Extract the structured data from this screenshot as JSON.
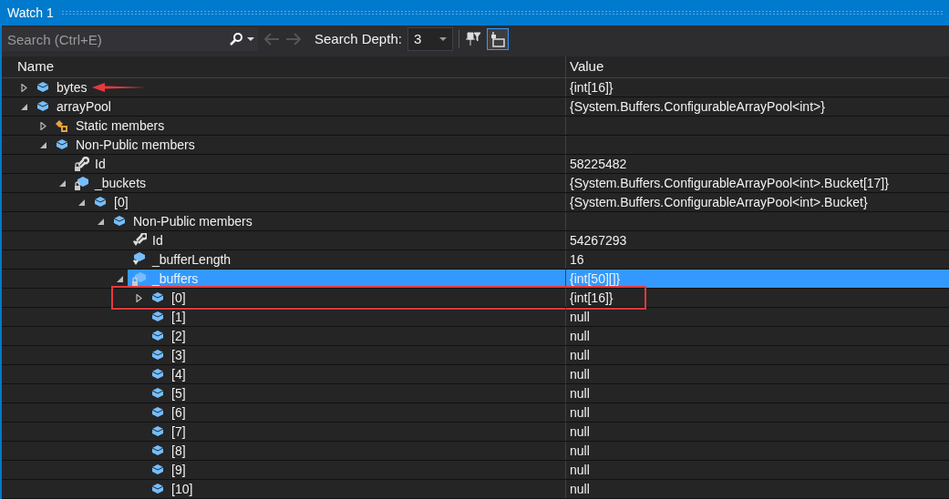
{
  "window": {
    "title": "Watch 1"
  },
  "toolbar": {
    "search": {
      "placeholder": "Search (Ctrl+E)"
    },
    "search_depth": {
      "label": "Search Depth:",
      "value": "3"
    }
  },
  "table": {
    "columns": [
      "Name",
      "Value"
    ],
    "rows": [
      {
        "name": "bytes",
        "value": "{int[16]}",
        "kind": "object",
        "expanded": false,
        "selected": false,
        "arrow": true
      },
      {
        "name": "arrayPool",
        "value": "{System.Buffers.ConfigurableArrayPool<int>}",
        "kind": "object",
        "expanded": true,
        "selected": false,
        "children": [
          {
            "name": "Static members",
            "kind": "static",
            "expanded": false,
            "selected": false
          },
          {
            "name": "Non-Public members",
            "kind": "object",
            "expanded": true,
            "selected": false,
            "children": [
              {
                "name": "Id",
                "value": "58225482",
                "kind": "private-property",
                "selected": false
              },
              {
                "name": "_buckets",
                "value": "{System.Buffers.ConfigurableArrayPool<int>.Bucket[17]}",
                "kind": "private-field",
                "expanded": true,
                "selected": false,
                "children": [
                  {
                    "name": "[0]",
                    "value": "{System.Buffers.ConfigurableArrayPool<int>.Bucket}",
                    "kind": "object",
                    "expanded": true,
                    "selected": false,
                    "children": [
                      {
                        "name": "Non-Public members",
                        "kind": "object",
                        "expanded": true,
                        "selected": false,
                        "children": [
                          {
                            "name": "Id",
                            "value": "54267293",
                            "kind": "property",
                            "selected": false
                          },
                          {
                            "name": "_bufferLength",
                            "value": "16",
                            "kind": "field",
                            "selected": false
                          },
                          {
                            "name": "_buffers",
                            "value": "{int[50][]}",
                            "kind": "private-field",
                            "expanded": true,
                            "selected": true,
                            "children": [
                              {
                                "name": "[0]",
                                "value": "{int[16]}",
                                "kind": "object",
                                "expanded": false,
                                "selected": false,
                                "boxed": true
                              },
                              {
                                "name": "[1]",
                                "value": "null",
                                "kind": "object",
                                "selected": false
                              },
                              {
                                "name": "[2]",
                                "value": "null",
                                "kind": "object",
                                "selected": false
                              },
                              {
                                "name": "[3]",
                                "value": "null",
                                "kind": "object",
                                "selected": false
                              },
                              {
                                "name": "[4]",
                                "value": "null",
                                "kind": "object",
                                "selected": false
                              },
                              {
                                "name": "[5]",
                                "value": "null",
                                "kind": "object",
                                "selected": false
                              },
                              {
                                "name": "[6]",
                                "value": "null",
                                "kind": "object",
                                "selected": false
                              },
                              {
                                "name": "[7]",
                                "value": "null",
                                "kind": "object",
                                "selected": false
                              },
                              {
                                "name": "[8]",
                                "value": "null",
                                "kind": "object",
                                "selected": false
                              },
                              {
                                "name": "[9]",
                                "value": "null",
                                "kind": "object",
                                "selected": false
                              },
                              {
                                "name": "[10]",
                                "value": "null",
                                "kind": "object",
                                "selected": false
                              }
                            ]
                          }
                        ]
                      }
                    ]
                  }
                ]
              }
            ]
          }
        ]
      }
    ]
  }
}
